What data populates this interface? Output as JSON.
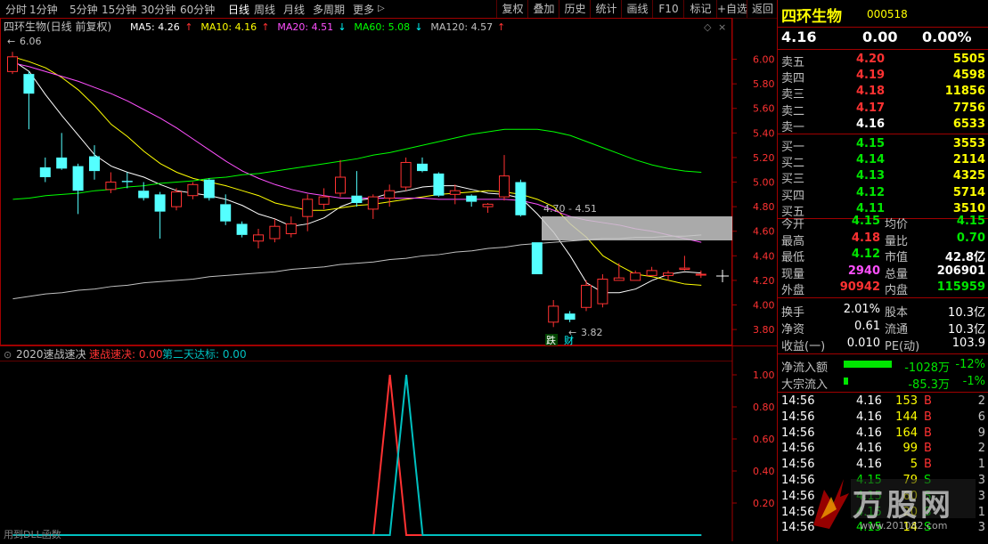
{
  "toolbar": {
    "periods": [
      "分时",
      "1分钟",
      "5分钟",
      "15分钟",
      "30分钟",
      "60分钟",
      "日线",
      "周线",
      "月线",
      "多周期",
      "更多"
    ],
    "active_period": "日线",
    "more_arrow": "▷",
    "right_buttons": [
      "复权",
      "叠加",
      "历史",
      "统计",
      "画线",
      "F10",
      "标记",
      "+自选",
      "返回"
    ]
  },
  "main_chart": {
    "stock_title": "四环生物(日线 前复权)",
    "ma_legend": [
      {
        "label": "MA5: 4.26",
        "arrow": "↑",
        "color": "#ffffff"
      },
      {
        "label": "MA10: 4.16",
        "arrow": "↑",
        "color": "#ffff00"
      },
      {
        "label": "MA20: 4.51",
        "arrow": "↓",
        "color": "#ff50ff"
      },
      {
        "label": "MA60: 5.08",
        "arrow": "↓",
        "color": "#00ff00"
      },
      {
        "label": "MA120: 4.57",
        "arrow": "↑",
        "color": "#c0c0c0"
      }
    ],
    "high_marker": "6.06",
    "low_marker": "3.82",
    "gap_label": "4.70 - 4.51",
    "signal_labels": [
      "跌",
      "财"
    ],
    "y_ticks": [
      "6.00",
      "5.80",
      "5.60",
      "5.40",
      "5.20",
      "5.00",
      "4.80",
      "4.60",
      "4.40",
      "4.20",
      "4.00",
      "3.80"
    ],
    "ylim": [
      3.75,
      6.12
    ]
  },
  "sub_chart": {
    "title": "2020速战速决",
    "series": [
      {
        "label": "速战速决: 0.00",
        "color": "#ff3232"
      },
      {
        "label": "第二天达标: 0.00",
        "color": "#00c0c0"
      }
    ],
    "y_ticks": [
      "1.00",
      "0.80",
      "0.60",
      "0.40",
      "0.20"
    ],
    "footer": "用到DLL函数"
  },
  "chart_data": {
    "type": "candlestick",
    "title": "四环生物(日线 前复权)",
    "candles": [
      {
        "o": 5.9,
        "c": 6.02,
        "h": 6.06,
        "l": 5.88
      },
      {
        "o": 5.88,
        "c": 5.72,
        "h": 5.9,
        "l": 5.43
      },
      {
        "o": 5.12,
        "c": 5.04,
        "h": 5.2,
        "l": 5.0
      },
      {
        "o": 5.2,
        "c": 5.11,
        "h": 5.4,
        "l": 5.1
      },
      {
        "o": 5.13,
        "c": 4.93,
        "h": 5.15,
        "l": 4.74
      },
      {
        "o": 5.21,
        "c": 5.09,
        "h": 5.3,
        "l": 5.02
      },
      {
        "o": 4.94,
        "c": 5.0,
        "h": 5.08,
        "l": 4.91
      },
      {
        "o": 5.01,
        "c": 5.0,
        "h": 5.08,
        "l": 4.95
      },
      {
        "o": 4.93,
        "c": 4.87,
        "h": 5.0,
        "l": 4.85
      },
      {
        "o": 4.9,
        "c": 4.76,
        "h": 4.92,
        "l": 4.54
      },
      {
        "o": 4.8,
        "c": 4.92,
        "h": 4.95,
        "l": 4.77
      },
      {
        "o": 4.89,
        "c": 4.98,
        "h": 5.0,
        "l": 4.86
      },
      {
        "o": 5.02,
        "c": 4.87,
        "h": 5.03,
        "l": 4.85
      },
      {
        "o": 4.82,
        "c": 4.68,
        "h": 4.9,
        "l": 4.65
      },
      {
        "o": 4.66,
        "c": 4.57,
        "h": 4.68,
        "l": 4.55
      },
      {
        "o": 4.52,
        "c": 4.57,
        "h": 4.62,
        "l": 4.46
      },
      {
        "o": 4.54,
        "c": 4.64,
        "h": 4.7,
        "l": 4.51
      },
      {
        "o": 4.58,
        "c": 4.66,
        "h": 4.72,
        "l": 4.55
      },
      {
        "o": 4.72,
        "c": 4.86,
        "h": 4.9,
        "l": 4.6
      },
      {
        "o": 4.82,
        "c": 4.88,
        "h": 4.95,
        "l": 4.78
      },
      {
        "o": 4.91,
        "c": 5.04,
        "h": 5.18,
        "l": 4.88
      },
      {
        "o": 4.89,
        "c": 4.83,
        "h": 5.09,
        "l": 4.8
      },
      {
        "o": 4.78,
        "c": 4.88,
        "h": 4.9,
        "l": 4.7
      },
      {
        "o": 4.87,
        "c": 4.93,
        "h": 4.98,
        "l": 4.8
      },
      {
        "o": 4.96,
        "c": 5.16,
        "h": 5.2,
        "l": 4.93
      },
      {
        "o": 5.15,
        "c": 5.09,
        "h": 5.2,
        "l": 5.08
      },
      {
        "o": 5.07,
        "c": 4.89,
        "h": 5.08,
        "l": 4.88
      },
      {
        "o": 4.9,
        "c": 4.93,
        "h": 4.98,
        "l": 4.82
      },
      {
        "o": 4.89,
        "c": 4.84,
        "h": 4.9,
        "l": 4.8
      },
      {
        "o": 4.8,
        "c": 4.82,
        "h": 4.83,
        "l": 4.75
      },
      {
        "o": 4.88,
        "c": 5.05,
        "h": 5.22,
        "l": 4.85
      },
      {
        "o": 5.0,
        "c": 4.73,
        "h": 5.02,
        "l": 4.72
      },
      {
        "o": 4.51,
        "c": 4.25,
        "h": 4.51,
        "l": 4.25
      },
      {
        "o": 3.86,
        "c": 3.99,
        "h": 4.04,
        "l": 3.82
      },
      {
        "o": 3.93,
        "c": 3.88,
        "h": 3.95,
        "l": 3.86
      },
      {
        "o": 3.98,
        "c": 4.16,
        "h": 4.2,
        "l": 3.95
      },
      {
        "o": 4.01,
        "c": 4.21,
        "h": 4.25,
        "l": 3.98
      },
      {
        "o": 4.2,
        "c": 4.22,
        "h": 4.34,
        "l": 4.2
      },
      {
        "o": 4.2,
        "c": 4.26,
        "h": 4.28,
        "l": 4.2
      },
      {
        "o": 4.24,
        "c": 4.28,
        "h": 4.31,
        "l": 4.24
      },
      {
        "o": 4.24,
        "c": 4.26,
        "h": 4.28,
        "l": 4.2
      },
      {
        "o": 4.29,
        "c": 4.3,
        "h": 4.4,
        "l": 4.28
      },
      {
        "o": 4.25,
        "c": 4.25,
        "h": 4.28,
        "l": 4.22
      }
    ],
    "ma_lines": [
      {
        "name": "MA5",
        "color": "#ffffff",
        "values": [
          5.99,
          5.9,
          5.71,
          5.54,
          5.38,
          5.22,
          5.13,
          5.08,
          5.04,
          4.98,
          4.93,
          4.91,
          4.89,
          4.86,
          4.81,
          4.74,
          4.7,
          4.64,
          4.66,
          4.71,
          4.8,
          4.85,
          4.87,
          4.91,
          4.93,
          4.96,
          4.97,
          4.97,
          4.94,
          4.91,
          4.9,
          4.87,
          4.74,
          4.59,
          4.4,
          4.18,
          4.1,
          4.1,
          4.13,
          4.2,
          4.25,
          4.27,
          4.26
        ]
      },
      {
        "name": "MA10",
        "color": "#ffff00",
        "values": [
          6.02,
          5.98,
          5.93,
          5.85,
          5.75,
          5.62,
          5.47,
          5.37,
          5.25,
          5.15,
          5.08,
          5.03,
          5.0,
          4.97,
          4.93,
          4.89,
          4.83,
          4.8,
          4.77,
          4.77,
          4.79,
          4.81,
          4.82,
          4.84,
          4.86,
          4.88,
          4.9,
          4.91,
          4.92,
          4.93,
          4.92,
          4.9,
          4.86,
          4.8,
          4.66,
          4.55,
          4.4,
          4.32,
          4.25,
          4.23,
          4.2,
          4.17,
          4.16
        ]
      },
      {
        "name": "MA20",
        "color": "#ff50ff",
        "values": [
          5.97,
          5.94,
          5.9,
          5.86,
          5.82,
          5.77,
          5.72,
          5.66,
          5.59,
          5.52,
          5.44,
          5.35,
          5.26,
          5.17,
          5.09,
          5.03,
          4.98,
          4.94,
          4.91,
          4.89,
          4.87,
          4.87,
          4.87,
          4.87,
          4.87,
          4.87,
          4.86,
          4.86,
          4.86,
          4.86,
          4.86,
          4.85,
          4.82,
          4.77,
          4.72,
          4.69,
          4.67,
          4.65,
          4.62,
          4.6,
          4.57,
          4.54,
          4.51
        ]
      },
      {
        "name": "MA60",
        "color": "#00ff00",
        "values": [
          4.86,
          4.87,
          4.89,
          4.9,
          4.91,
          4.93,
          4.94,
          4.96,
          4.97,
          4.99,
          5.0,
          5.01,
          5.03,
          5.04,
          5.06,
          5.07,
          5.09,
          5.11,
          5.13,
          5.15,
          5.17,
          5.19,
          5.22,
          5.24,
          5.27,
          5.3,
          5.33,
          5.36,
          5.39,
          5.41,
          5.43,
          5.43,
          5.43,
          5.41,
          5.38,
          5.33,
          5.28,
          5.23,
          5.18,
          5.14,
          5.11,
          5.09,
          5.08
        ]
      },
      {
        "name": "MA120",
        "color": "#c0c0c0",
        "values": [
          4.05,
          4.07,
          4.09,
          4.1,
          4.12,
          4.13,
          4.15,
          4.16,
          4.18,
          4.19,
          4.2,
          4.21,
          4.23,
          4.24,
          4.25,
          4.26,
          4.27,
          4.29,
          4.3,
          4.31,
          4.33,
          4.34,
          4.35,
          4.37,
          4.38,
          4.4,
          4.41,
          4.43,
          4.44,
          4.46,
          4.47,
          4.49,
          4.5,
          4.51,
          4.52,
          4.53,
          4.54,
          4.54,
          4.55,
          4.55,
          4.56,
          4.56,
          4.57
        ]
      }
    ],
    "indicator": {
      "name": "2020速战速决",
      "ylim": [
        0,
        1.05
      ],
      "series": [
        {
          "name": "速战速决",
          "color": "#ff3232",
          "peak_index": 23,
          "peak": 1.0
        },
        {
          "name": "第二天达标",
          "color": "#00c0c0",
          "peak_index": 24,
          "peak": 1.0
        }
      ]
    }
  },
  "quote": {
    "name": "四环生物",
    "code": "000518",
    "price": "4.16",
    "change": "0.00",
    "change_pct": "0.00%",
    "asks": [
      {
        "label": "卖五",
        "price": "4.20",
        "vol": "5505",
        "color": "red"
      },
      {
        "label": "卖四",
        "price": "4.19",
        "vol": "4598",
        "color": "red"
      },
      {
        "label": "卖三",
        "price": "4.18",
        "vol": "11856",
        "color": "red"
      },
      {
        "label": "卖二",
        "price": "4.17",
        "vol": "7756",
        "color": "red"
      },
      {
        "label": "卖一",
        "price": "4.16",
        "vol": "6533",
        "color": "white"
      }
    ],
    "bids": [
      {
        "label": "买一",
        "price": "4.15",
        "vol": "3553",
        "color": "green"
      },
      {
        "label": "买二",
        "price": "4.14",
        "vol": "2114",
        "color": "green"
      },
      {
        "label": "买三",
        "price": "4.13",
        "vol": "4325",
        "color": "green"
      },
      {
        "label": "买四",
        "price": "4.12",
        "vol": "5714",
        "color": "green"
      },
      {
        "label": "买五",
        "price": "4.11",
        "vol": "3510",
        "color": "green"
      }
    ],
    "stats": [
      {
        "l1": "今开",
        "v1": "4.15",
        "c1": "green",
        "l2": "均价",
        "v2": "4.15",
        "c2": "green"
      },
      {
        "l1": "最高",
        "v1": "4.18",
        "c1": "red",
        "l2": "量比",
        "v2": "0.70",
        "c2": "green"
      },
      {
        "l1": "最低",
        "v1": "4.12",
        "c1": "green",
        "l2": "市值",
        "v2": "42.8亿",
        "c2": "white"
      },
      {
        "l1": "现量",
        "v1": "2940",
        "c1": "magenta",
        "l2": "总量",
        "v2": "206901",
        "c2": "white"
      },
      {
        "l1": "外盘",
        "v1": "90942",
        "c1": "red",
        "l2": "内盘",
        "v2": "115959",
        "c2": "green"
      }
    ],
    "fundamentals": [
      {
        "l1": "换手",
        "v1": "2.01%",
        "l2": "股本",
        "v2": "10.3亿"
      },
      {
        "l1": "净资",
        "v1": "0.61",
        "l2": "流通",
        "v2": "10.3亿"
      },
      {
        "l1": "收益(一)",
        "v1": "0.010",
        "l2": "PE(动)",
        "v2": "103.9"
      }
    ],
    "flows": [
      {
        "label": "净流入额",
        "value": "-1028万",
        "pct": "-12%",
        "bar": 0.12
      },
      {
        "label": "大宗流入",
        "value": "-85.3万",
        "pct": "-1%",
        "bar": 0.01
      }
    ],
    "ticks": [
      {
        "time": "14:56",
        "price": "4.16",
        "vol": "153",
        "bs": "B",
        "n": "2",
        "pc": "white",
        "vc": "yellow",
        "bc": "red"
      },
      {
        "time": "14:56",
        "price": "4.16",
        "vol": "144",
        "bs": "B",
        "n": "6",
        "pc": "white",
        "vc": "yellow",
        "bc": "red"
      },
      {
        "time": "14:56",
        "price": "4.16",
        "vol": "164",
        "bs": "B",
        "n": "9",
        "pc": "white",
        "vc": "yellow",
        "bc": "red"
      },
      {
        "time": "14:56",
        "price": "4.16",
        "vol": "99",
        "bs": "B",
        "n": "2",
        "pc": "white",
        "vc": "yellow",
        "bc": "red"
      },
      {
        "time": "14:56",
        "price": "4.16",
        "vol": "5",
        "bs": "B",
        "n": "1",
        "pc": "white",
        "vc": "yellow",
        "bc": "red"
      },
      {
        "time": "14:56",
        "price": "4.15",
        "vol": "79",
        "bs": "S",
        "n": "3",
        "pc": "green",
        "vc": "yellow",
        "bc": "green"
      },
      {
        "time": "14:56",
        "price": "4.15",
        "vol": "60",
        "bs": "S",
        "n": "3",
        "pc": "green",
        "vc": "yellow",
        "bc": "green"
      },
      {
        "time": "14:56",
        "price": "4.15",
        "vol": "20",
        "bs": "S",
        "n": "1",
        "pc": "green",
        "vc": "yellow",
        "bc": "green"
      },
      {
        "time": "14:56",
        "price": "4.15",
        "vol": "14",
        "bs": "S",
        "n": "3",
        "pc": "green",
        "vc": "yellow",
        "bc": "green"
      }
    ]
  },
  "watermark": {
    "text": "万股网",
    "url": "www.201082.com"
  }
}
